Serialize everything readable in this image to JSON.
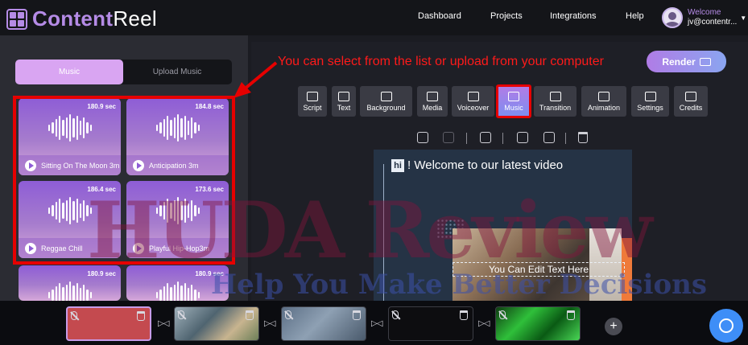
{
  "app": {
    "logo_part1": "Content",
    "logo_part2": "Reel"
  },
  "nav": {
    "dashboard": "Dashboard",
    "projects": "Projects",
    "integrations": "Integrations",
    "help": "Help"
  },
  "user": {
    "welcome": "Welcome",
    "email": "jv@contentr..."
  },
  "left_panel": {
    "tabs": {
      "music": "Music",
      "upload": "Upload Music"
    },
    "tracks": [
      {
        "duration": "180.9 sec",
        "name": "Sitting On The Moon 3m"
      },
      {
        "duration": "184.8 sec",
        "name": "Anticipation 3m"
      },
      {
        "duration": "186.4 sec",
        "name": "Reggae Chill"
      },
      {
        "duration": "173.6 sec",
        "name": "Playful Hip-Hop3m"
      },
      {
        "duration": "180.9 sec",
        "name": ""
      },
      {
        "duration": "180.9 sec",
        "name": ""
      }
    ]
  },
  "annotation": {
    "text": "You can select from the list or upload from your computer"
  },
  "render": {
    "label": "Render"
  },
  "toolbar": {
    "items": [
      "Script",
      "Text",
      "Background",
      "Media",
      "Voiceover",
      "Music",
      "Transition",
      "Animation",
      "Settings",
      "Credits"
    ],
    "active": "Music"
  },
  "canvas": {
    "hi_badge": "hi",
    "headline": "! Welcome to our latest video",
    "edit_text": "You Can Edit Text Here"
  },
  "watermark": {
    "line1": "HUDA Review",
    "line2": "Help You Make Better Decisions"
  },
  "timeline": {
    "add_label": "+"
  },
  "colors": {
    "accent": "#b58be6",
    "annotation_red": "#e60000",
    "chat_blue": "#3e8ef7"
  }
}
